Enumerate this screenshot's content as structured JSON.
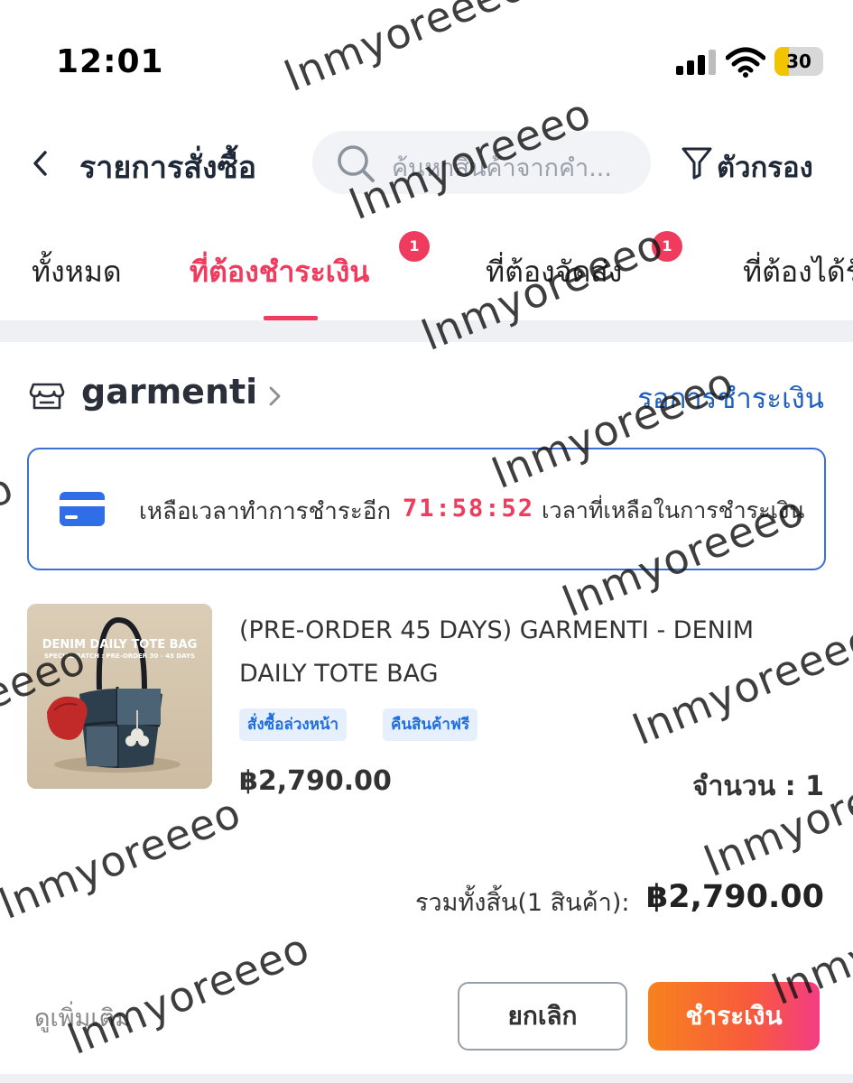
{
  "status_bar": {
    "time": "12:01",
    "battery_level": "30",
    "battery_fill_fraction": 0.3,
    "signal_bars_filled": 3,
    "signal_bars_total": 4
  },
  "header": {
    "title": "รายการสั่งซื้อ",
    "search_placeholder": "ค้นหาสินค้าจากคำ...",
    "filter_label": "ตัวกรอง"
  },
  "tabs": [
    {
      "label": "ทั้งหมด",
      "active": false,
      "badge": ""
    },
    {
      "label": "ที่ต้องชำระเงิน",
      "active": true,
      "badge": "1"
    },
    {
      "label": "ที่ต้องจัดส่ง",
      "active": false,
      "badge": "1"
    },
    {
      "label": "ที่ต้องได้รับ",
      "active": false,
      "badge": ""
    }
  ],
  "order": {
    "shop_name": "garmenti",
    "status": "รอการชำระเงิน",
    "timer": {
      "label": "เหลือเวลาทำการชำระอีก",
      "value": "71:58:52",
      "suffix": "เวลาที่เหลือในการชำระเงิน"
    },
    "product": {
      "image_title": "DENIM DAILY TOTE BAG",
      "image_subtitle": "SPECIAL BATCH : PRE-ORDER 30 - 45 DAYS",
      "title": "(PRE-ORDER 45 DAYS) GARMENTI - DENIM DAILY TOTE BAG",
      "tags": [
        "สั่งซื้อล่วงหน้า",
        "คืนสินค้าฟรี"
      ],
      "price": "฿2,790.00",
      "quantity_label": "จำนวน : 1"
    },
    "total_label": "รวมทั้งสิ้น(1 สินค้า):",
    "total_value": "฿2,790.00",
    "see_more": "ดูเพิ่มเติม",
    "cancel_button": "ยกเลิก",
    "pay_button": "ชำระเงิน"
  },
  "watermark": "lnmyoreeeo",
  "colors": {
    "accent": "#ef3b5d",
    "link_blue": "#1f5fbf",
    "tag_blue": "#1f6fe0",
    "pay_gradient_start": "#f7821d",
    "pay_gradient_end": "#f43c83"
  }
}
